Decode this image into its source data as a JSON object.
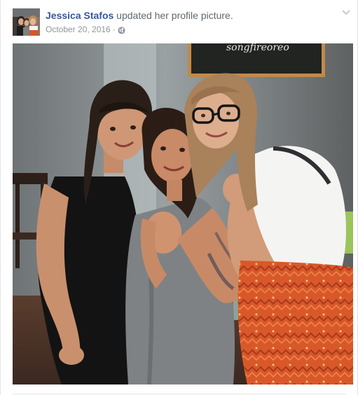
{
  "post": {
    "author_name": "Jessica Stafos",
    "action_text": " updated her profile picture.",
    "date": "October 20, 2016",
    "separator": "·",
    "audience_icon": "globe-icon",
    "options_icon": "chevron-down-icon",
    "photo_chalkboard_text": "songfireoreo"
  },
  "colors": {
    "name_link": "#365899",
    "body_text": "#606770",
    "meta_text": "#90949c",
    "border": "#dddfe2"
  }
}
